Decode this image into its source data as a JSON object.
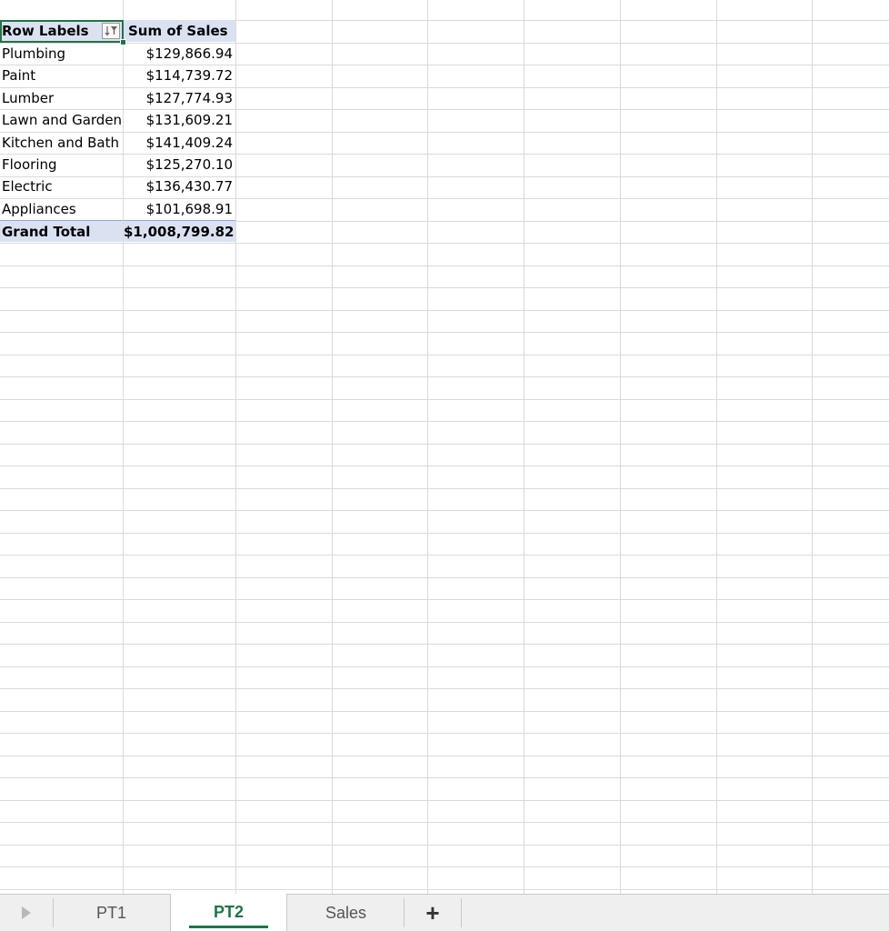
{
  "pivot": {
    "header": {
      "row_labels": "Row Labels",
      "sum_of_sales": "Sum of Sales"
    },
    "rows": [
      {
        "label": "Plumbing",
        "value": "$129,866.94"
      },
      {
        "label": "Paint",
        "value": "$114,739.72"
      },
      {
        "label": "Lumber",
        "value": "$127,774.93"
      },
      {
        "label": "Lawn and Garden",
        "value": "$131,609.21"
      },
      {
        "label": "Kitchen and Bath",
        "value": "$141,409.24"
      },
      {
        "label": "Flooring",
        "value": "$125,270.10"
      },
      {
        "label": "Electric",
        "value": "$136,430.77"
      },
      {
        "label": "Appliances",
        "value": "$101,698.91"
      }
    ],
    "total": {
      "label": "Grand Total",
      "value": "$1,008,799.82"
    }
  },
  "sheet_tabs": {
    "items": [
      {
        "label": "PT1",
        "active": false
      },
      {
        "label": "PT2",
        "active": true
      },
      {
        "label": "Sales",
        "active": false
      }
    ],
    "add_label": "+"
  },
  "icons": {
    "filter": "sort-filter-icon",
    "scroll": "scroll-tabs-left-icon",
    "add": "add-sheet-icon"
  },
  "colors": {
    "accent": "#217346",
    "pivot_header_bg": "#dae2f2",
    "gridline": "#dadada"
  }
}
